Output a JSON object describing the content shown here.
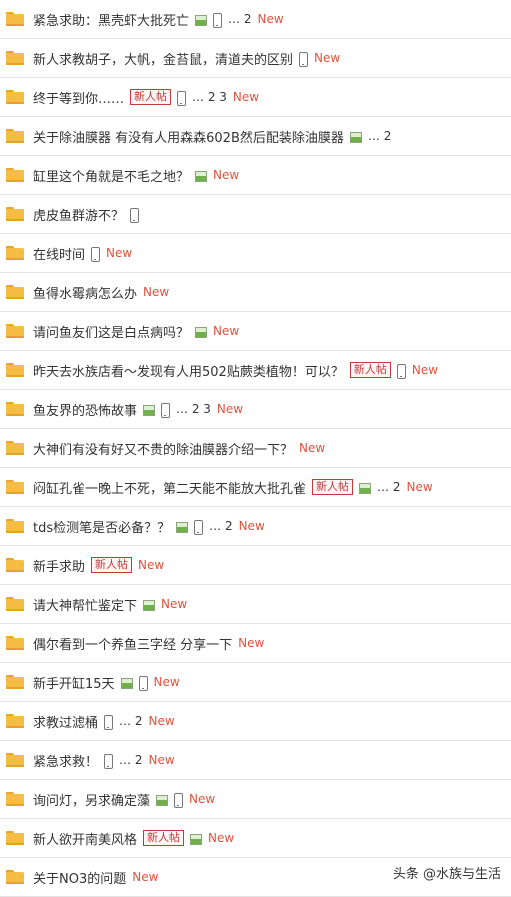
{
  "threads": [
    {
      "title": "紧急求助：黑壳虾大批死亡",
      "image": true,
      "mobile": true,
      "newbie": false,
      "pages": "… 2",
      "new": "New"
    },
    {
      "title": "新人求教胡子，大帆，金苔鼠，清道夫的区别",
      "image": false,
      "mobile": true,
      "newbie": false,
      "pages": "",
      "new": "New"
    },
    {
      "title": "终于等到你……",
      "image": false,
      "mobile": true,
      "newbie": true,
      "pages": "… 2  3",
      "new": "New"
    },
    {
      "title": "关于除油膜器 有没有人用森森602B然后配装除油膜器",
      "image": true,
      "mobile": false,
      "newbie": false,
      "pages": "… 2",
      "new": ""
    },
    {
      "title": "缸里这个角就是不毛之地？",
      "image": true,
      "mobile": false,
      "newbie": false,
      "pages": "",
      "new": "New"
    },
    {
      "title": "虎皮鱼群游不？",
      "image": false,
      "mobile": true,
      "newbie": false,
      "pages": "",
      "new": ""
    },
    {
      "title": "在线时间",
      "image": false,
      "mobile": true,
      "newbie": false,
      "pages": "",
      "new": "New"
    },
    {
      "title": "鱼得水霉病怎么办",
      "image": false,
      "mobile": false,
      "newbie": false,
      "pages": "",
      "new": "New"
    },
    {
      "title": "请问鱼友们这是白点病吗？",
      "image": true,
      "mobile": false,
      "newbie": false,
      "pages": "",
      "new": "New"
    },
    {
      "title": "昨天去水族店看～发现有人用502贴蕨类植物！可以？",
      "image": false,
      "mobile": true,
      "newbie": true,
      "pages": "",
      "new": "New"
    },
    {
      "title": "鱼友界的恐怖故事",
      "image": true,
      "mobile": true,
      "newbie": false,
      "pages": "… 2  3",
      "new": "New"
    },
    {
      "title": "大神们有没有好又不贵的除油膜器介绍一下？",
      "image": false,
      "mobile": false,
      "newbie": false,
      "pages": "",
      "new": "New"
    },
    {
      "title": "闷缸孔雀一晚上不死，第二天能不能放大批孔雀",
      "image": true,
      "mobile": false,
      "newbie": true,
      "pages": "… 2",
      "new": "New"
    },
    {
      "title": "tds检测笔是否必备？？",
      "image": true,
      "mobile": true,
      "newbie": false,
      "pages": "… 2",
      "new": "New"
    },
    {
      "title": "新手求助",
      "image": false,
      "mobile": false,
      "newbie": true,
      "pages": "",
      "new": "New"
    },
    {
      "title": "请大神帮忙鉴定下",
      "image": true,
      "mobile": false,
      "newbie": false,
      "pages": "",
      "new": "New"
    },
    {
      "title": "偶尔看到一个养鱼三字经 分享一下",
      "image": false,
      "mobile": false,
      "newbie": false,
      "pages": "",
      "new": "New"
    },
    {
      "title": "新手开缸15天",
      "image": true,
      "mobile": true,
      "newbie": false,
      "pages": "",
      "new": "New"
    },
    {
      "title": "求教过滤桶",
      "image": false,
      "mobile": true,
      "newbie": false,
      "pages": "… 2",
      "new": "New"
    },
    {
      "title": "紧急求救！",
      "image": false,
      "mobile": true,
      "newbie": false,
      "pages": "… 2",
      "new": "New"
    },
    {
      "title": "询问灯，另求确定藻",
      "image": true,
      "mobile": true,
      "newbie": false,
      "pages": "",
      "new": "New"
    },
    {
      "title": "新人欲开南美风格",
      "image": true,
      "mobile": false,
      "newbie": true,
      "pages": "",
      "new": "New"
    },
    {
      "title": "关于NO3的问题",
      "image": false,
      "mobile": false,
      "newbie": false,
      "pages": "",
      "new": "New"
    }
  ],
  "newbie_label": "新人帖",
  "watermark": "头条 @水族与生活",
  "colors": {
    "new": "#e2533c",
    "folder": "#f6bd44",
    "newbie": "#c23a3a",
    "divider": "#e3e3e3"
  },
  "icons": {
    "row": "folder-icon",
    "image": "image-icon",
    "mobile": "mobile-icon"
  }
}
